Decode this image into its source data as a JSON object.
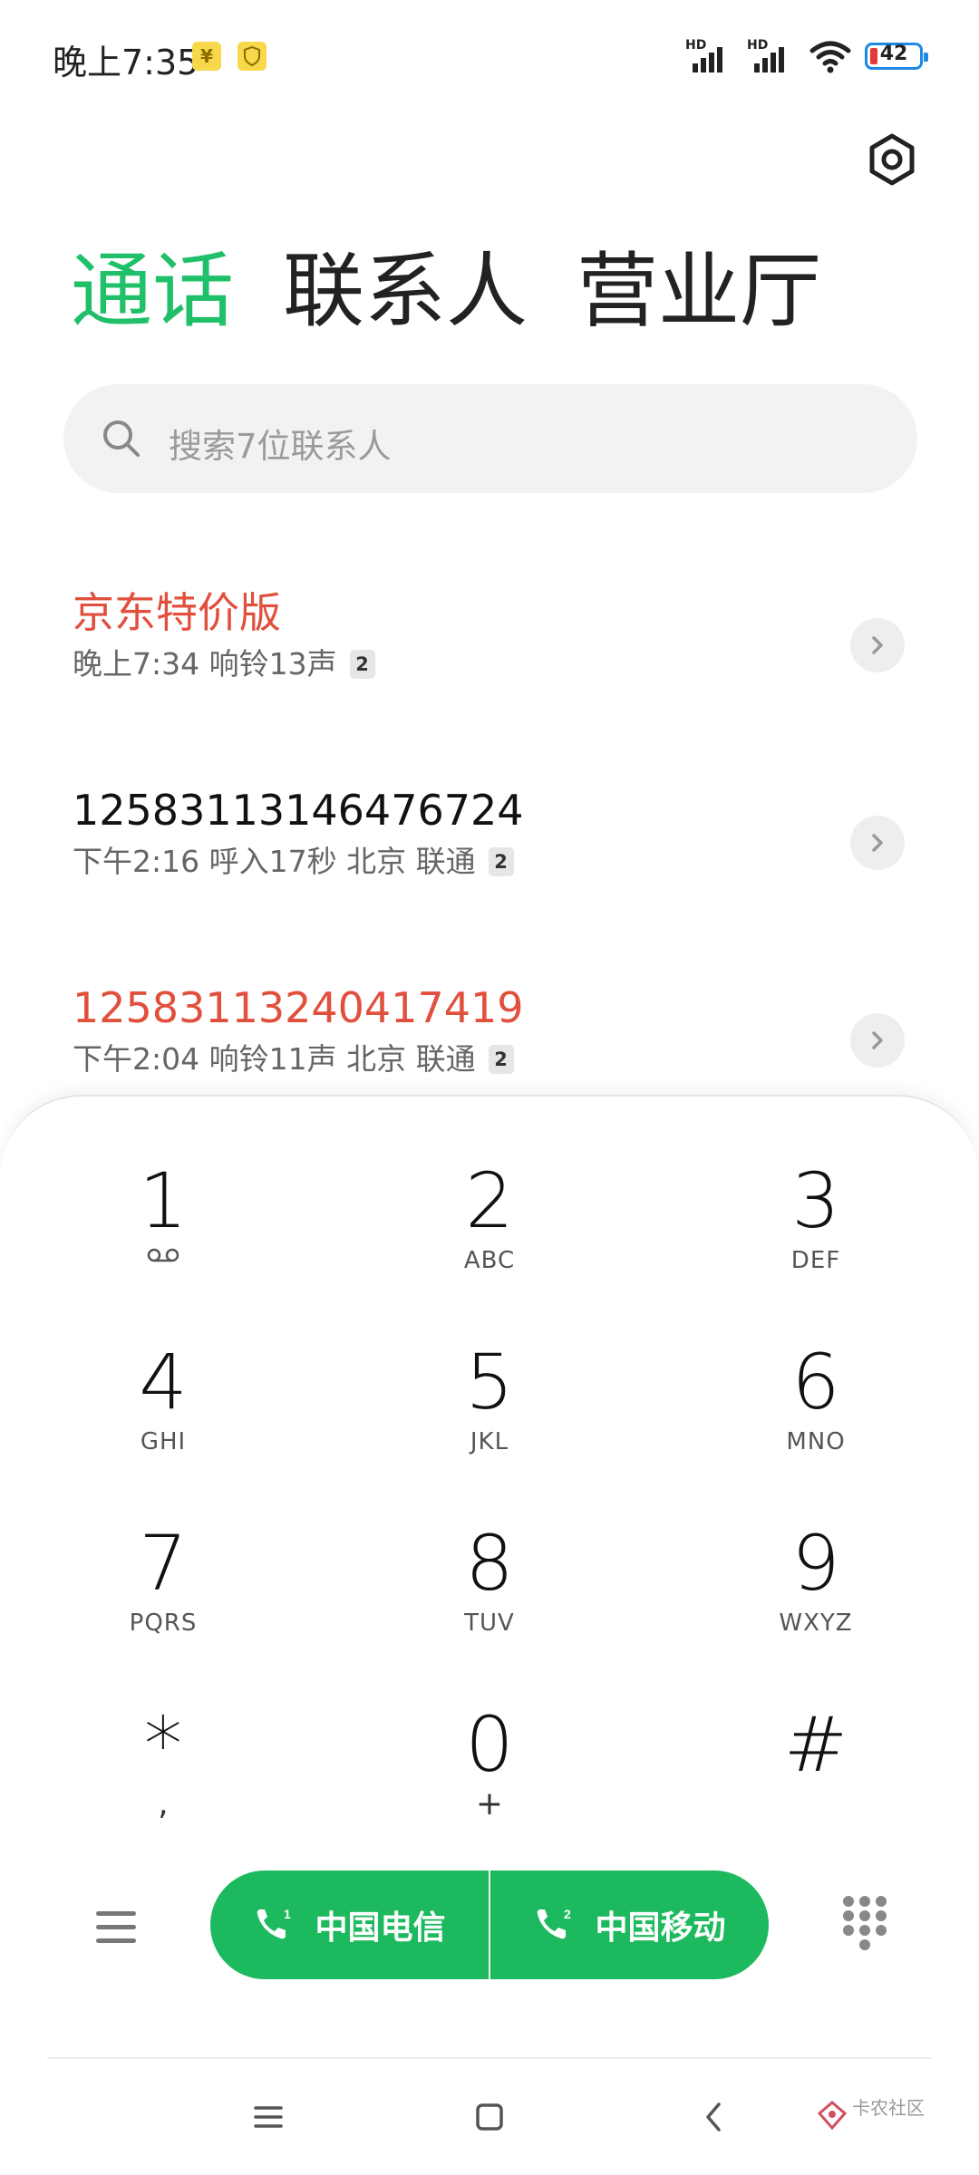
{
  "status_bar": {
    "time": "晚上7:35",
    "badge_1": "¥",
    "signal_1_label": "HD",
    "signal_2_label": "HD",
    "battery": "42"
  },
  "tabs": [
    {
      "label": "通话",
      "active": true
    },
    {
      "label": "联系人",
      "active": false
    },
    {
      "label": "营业厅",
      "active": false
    }
  ],
  "search": {
    "placeholder": "搜索7位联系人"
  },
  "calls": [
    {
      "name": "京东特价版",
      "detail": "晚上7:34 响铃13声",
      "sim": "2",
      "missed": true
    },
    {
      "name": "12583113146476724",
      "detail": "下午2:16 呼入17秒 北京 联通",
      "sim": "2",
      "missed": false
    },
    {
      "name": "12583113240417419",
      "detail": "下午2:04 响铃11声 北京 联通",
      "sim": "2",
      "missed": true
    }
  ],
  "dialpad": {
    "keys": [
      {
        "digit": "1",
        "letters": ""
      },
      {
        "digit": "2",
        "letters": "ABC"
      },
      {
        "digit": "3",
        "letters": "DEF"
      },
      {
        "digit": "4",
        "letters": "GHI"
      },
      {
        "digit": "5",
        "letters": "JKL"
      },
      {
        "digit": "6",
        "letters": "MNO"
      },
      {
        "digit": "7",
        "letters": "PQRS"
      },
      {
        "digit": "8",
        "letters": "TUV"
      },
      {
        "digit": "9",
        "letters": "WXYZ"
      },
      {
        "digit": "*",
        "letters": ","
      },
      {
        "digit": "0",
        "letters": "+"
      },
      {
        "digit": "#",
        "letters": ""
      }
    ]
  },
  "call_buttons": [
    {
      "label": "中国电信",
      "sim": "1"
    },
    {
      "label": "中国移动",
      "sim": "2"
    }
  ],
  "watermark": {
    "text": "卡农社区"
  },
  "colors": {
    "accent": "#20c06a",
    "call_green": "#1db95e",
    "missed_red": "#e0503c"
  },
  "icons": {
    "settings": "gear-icon",
    "search": "search-icon",
    "chevron": "chevron-right-icon",
    "voicemail": "voicemail-icon",
    "menu": "menu-icon",
    "keypad": "keypad-icon"
  }
}
